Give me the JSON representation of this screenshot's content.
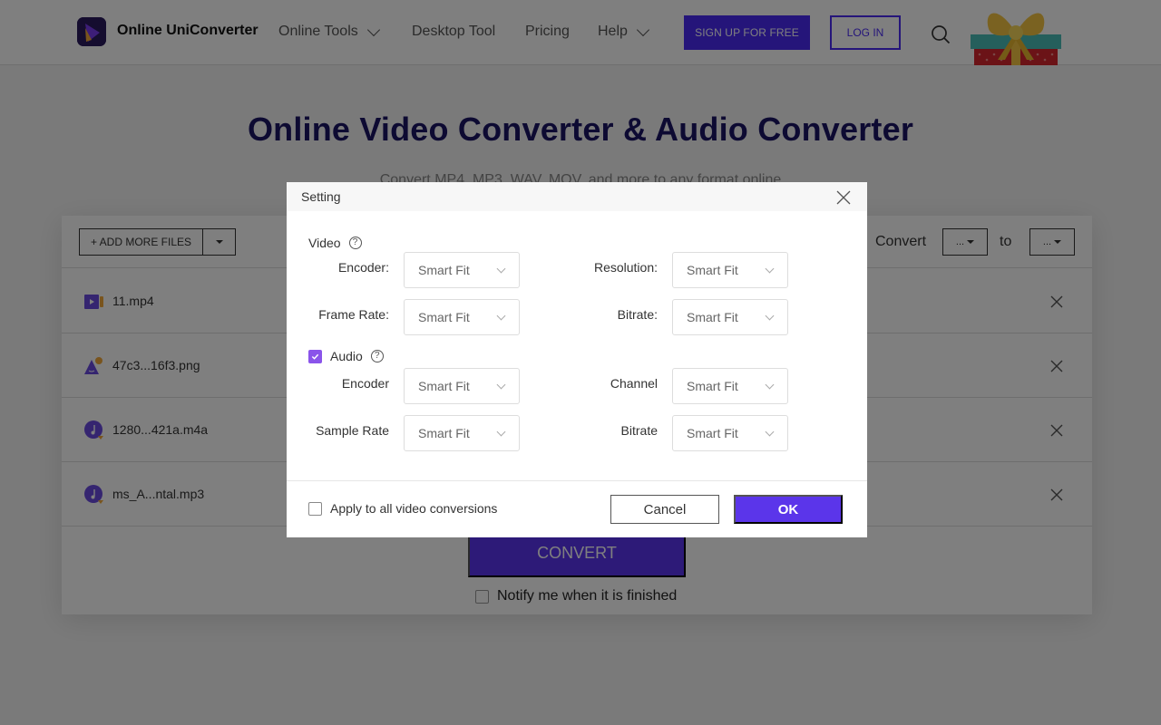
{
  "header": {
    "brand": "Online UniConverter",
    "nav": [
      {
        "label": "Online Tools",
        "has_dropdown": true
      },
      {
        "label": "Desktop Tool",
        "has_dropdown": false
      },
      {
        "label": "Pricing",
        "has_dropdown": false
      },
      {
        "label": "Help",
        "has_dropdown": true
      }
    ],
    "signup_label": "SIGN UP FOR FREE",
    "login_label": "LOG IN"
  },
  "hero": {
    "title": "Online Video Converter & Audio Converter",
    "subtitle": "Convert MP4, MP3, WAV, MOV, and more to any format online"
  },
  "converter": {
    "add_files_label": "+ ADD MORE FILES",
    "convert_label": "Convert",
    "from_format": "...",
    "to_label": "to",
    "to_format": "...",
    "files": [
      {
        "name": "11.mp4",
        "type": "video"
      },
      {
        "name": "47c3...16f3.png",
        "type": "image"
      },
      {
        "name": "1280...421a.m4a",
        "type": "audio"
      },
      {
        "name": "ms_A...ntal.mp3",
        "type": "audio"
      }
    ],
    "convert_button": "CONVERT",
    "notify_label": "Notify me when it is finished",
    "notify_checked": false
  },
  "dialog": {
    "title": "Setting",
    "video": {
      "label": "Video",
      "fields": {
        "encoder": {
          "label": "Encoder:",
          "value": "Smart Fit"
        },
        "resolution": {
          "label": "Resolution:",
          "value": "Smart Fit"
        },
        "frame_rate": {
          "label": "Frame Rate:",
          "value": "Smart Fit"
        },
        "bitrate": {
          "label": "Bitrate:",
          "value": "Smart Fit"
        }
      }
    },
    "audio": {
      "label": "Audio",
      "checked": true,
      "fields": {
        "encoder": {
          "label": "Encoder",
          "value": "Smart Fit"
        },
        "channel": {
          "label": "Channel",
          "value": "Smart Fit"
        },
        "sample_rate": {
          "label": "Sample Rate",
          "value": "Smart Fit"
        },
        "bitrate": {
          "label": "Bitrate",
          "value": "Smart Fit"
        }
      }
    },
    "apply_all_label": "Apply to all video conversions",
    "apply_all_checked": false,
    "cancel_label": "Cancel",
    "ok_label": "OK"
  },
  "colors": {
    "brand_purple": "#4a2bf5",
    "ok_purple": "#5b35ea",
    "checkbox_purple": "#8a54ea",
    "title_navy": "#1a1465"
  }
}
